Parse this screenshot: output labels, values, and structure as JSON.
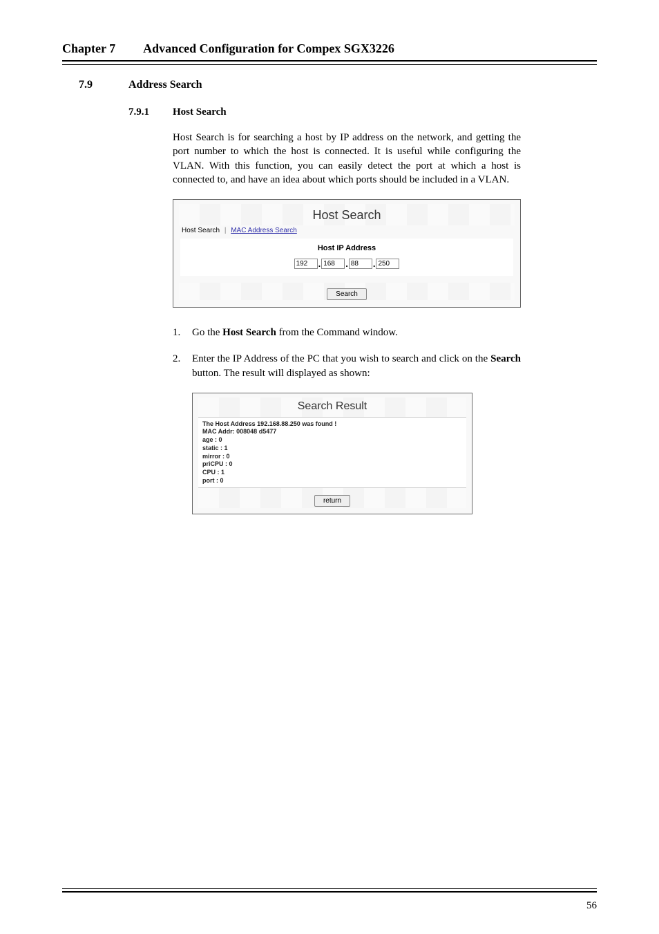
{
  "header": {
    "chapter_label": "Chapter 7",
    "chapter_title": "Advanced Configuration for Compex SGX3226"
  },
  "section": {
    "number": "7.9",
    "title": "Address Search"
  },
  "subsection": {
    "number": "7.9.1",
    "title": "Host Search"
  },
  "intro_para": "Host Search is for searching a host by IP address on the network, and getting the port number to which the host is connected. It is useful while configuring the VLAN. With this function, you can easily detect the port at which a host is connected to, and have an idea about which ports should be included in a VLAN.",
  "figure1": {
    "title": "Host Search",
    "tab_active": "Host Search",
    "tab_link": "MAC Address Search",
    "panel_label": "Host IP Address",
    "ip": {
      "o1": "192",
      "o2": "168",
      "o3": "88",
      "o4": "250"
    },
    "button": "Search"
  },
  "steps": [
    {
      "n": "1.",
      "pre": "Go the ",
      "bold": "Host Search",
      "post": " from the Command window."
    },
    {
      "n": "2.",
      "pre": "Enter the IP Address of the PC that you wish to search and click on the ",
      "bold": "Search",
      "post": " button. The result will displayed as shown:"
    }
  ],
  "figure2": {
    "title": "Search Result",
    "lines": [
      "The Host Address 192.168.88.250 was found !",
      "MAC Addr: 008048 d5477",
      "age : 0",
      "static : 1",
      "mirror : 0",
      "priCPU : 0",
      "CPU : 1",
      "port : 0"
    ],
    "button": "return"
  },
  "page_number": "56"
}
